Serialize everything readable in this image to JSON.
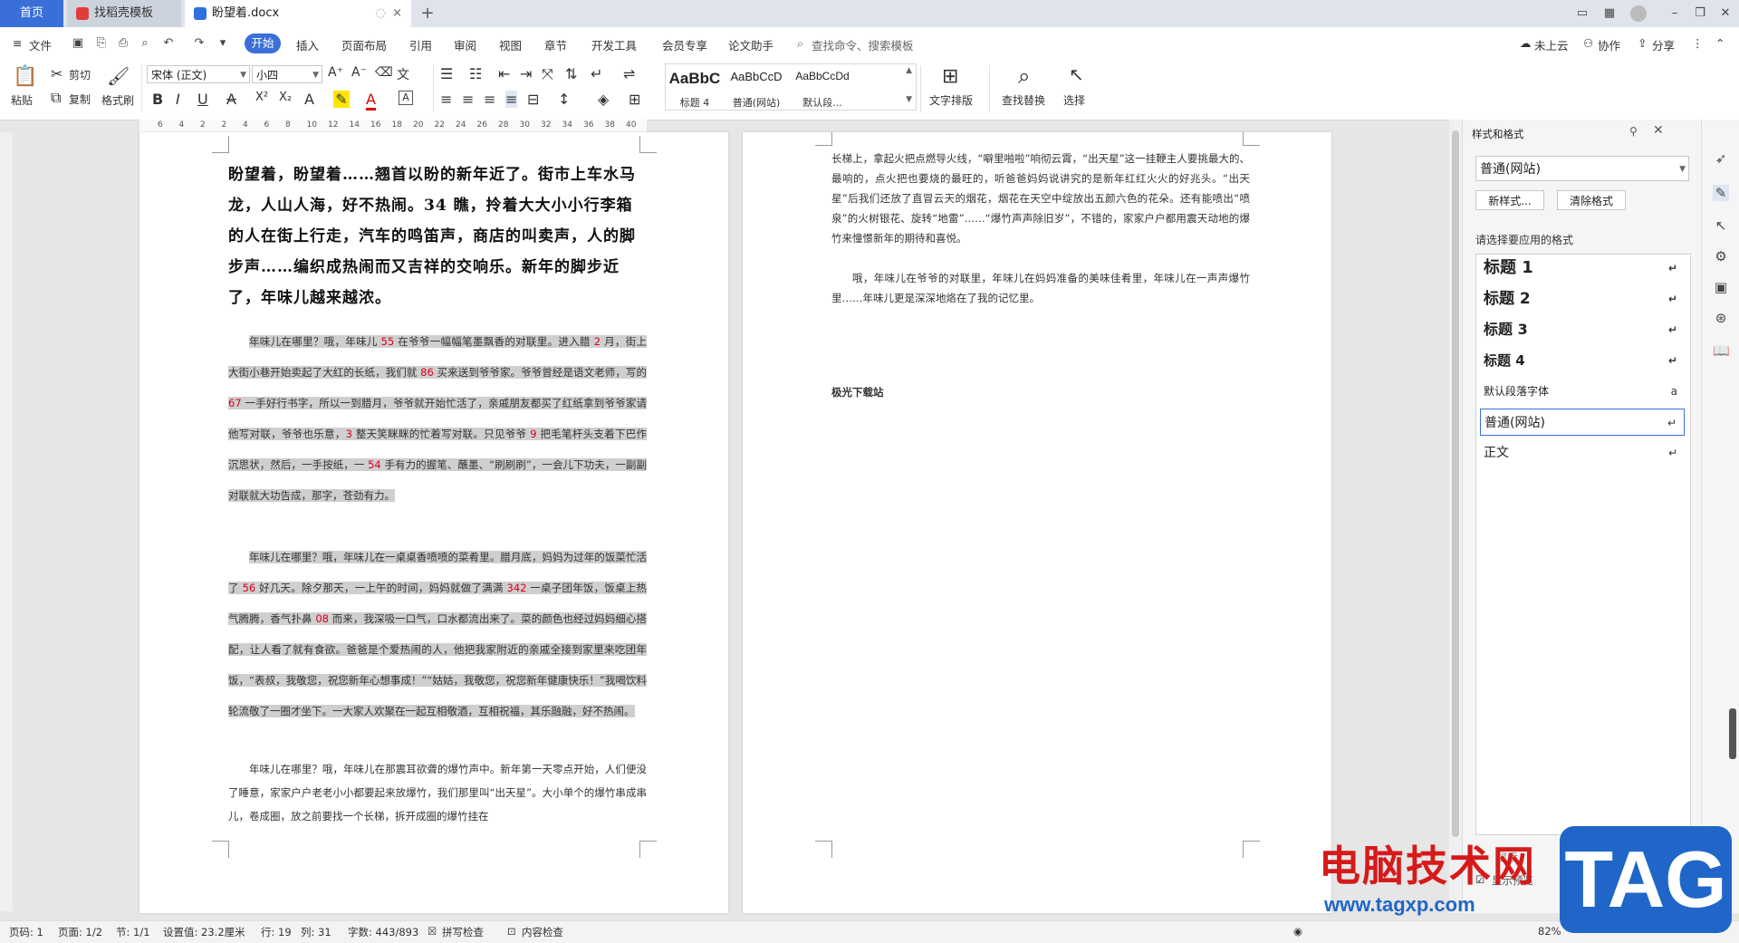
{
  "tabs": {
    "home": "首页",
    "find_template": "找稻壳模板",
    "document": "盼望着.docx",
    "add": "+"
  },
  "menu": {
    "file": "文件",
    "start": "开始",
    "insert": "插入",
    "page_layout": "页面布局",
    "reference": "引用",
    "review": "审阅",
    "view": "视图",
    "chapter": "章节",
    "dev_tools": "开发工具",
    "member": "会员专享",
    "essay": "论文助手",
    "search": "查找命令、搜索模板",
    "cloud": "未上云",
    "collab": "协作",
    "share": "分享"
  },
  "ribbon": {
    "paste": "粘贴",
    "cut": "剪切",
    "copy": "复制",
    "format_painter": "格式刷",
    "font_name": "宋体 (正文)",
    "font_size": "小四",
    "styles": [
      {
        "sample": "AaBbC",
        "name": "标题 4"
      },
      {
        "sample": "AaBbCcD",
        "name": "普通(网站)"
      },
      {
        "sample": "AaBbCcDd",
        "name": "默认段..."
      }
    ],
    "text_layout": "文字排版",
    "find_replace": "查找替换",
    "select": "选择"
  },
  "ruler": [
    "6",
    "4",
    "2",
    "2",
    "4",
    "6",
    "8",
    "10",
    "12",
    "14",
    "16",
    "18",
    "20",
    "22",
    "24",
    "26",
    "28",
    "30",
    "32",
    "34",
    "36",
    "38",
    "40"
  ],
  "page1": {
    "heading": "盼望着，盼望着……翘首以盼的新年近了。街市上车水马龙，人山人海，好不热闹。34 瞧，拎着大大小小行李箱的人在街上行走，汽车的鸣笛声，商店的叫卖声，人的脚步声……编织成热闹而又吉祥的交响乐。新年的脚步近了，年味儿越来越浓。",
    "para1": [
      "年味儿在哪里？哦，年味儿 ",
      "55",
      " 在爷爷一幅幅笔墨飘香的对联里。进入腊 ",
      "2",
      " 月，街上大街小巷开始卖起了大红的长纸，我们就 ",
      "86",
      " 买来送到爷爷家。爷爷曾经是语文老师，写的 ",
      "67",
      " 一手好行书字，所以一到腊月，爷爷就开始忙活了，亲戚朋友都买了红纸拿到爷爷家请他写对联，爷爷也乐意，",
      "3",
      " 整天笑眯眯的忙着写对联。只见爷爷 ",
      "9",
      " 把毛笔杆头支着下巴作沉思状，然后，一手按纸，一 ",
      "54",
      " 手有力的握笔、蘸墨、“刷刷刷”，一会儿下功夫，一副副对联就大功告成，那字，苍劲有力。"
    ],
    "para2": [
      "年味儿在哪里？哦，年味儿在一桌桌香喷喷的菜肴里。腊月底，妈妈为过年的饭菜忙活了 ",
      "56",
      " 好几天。除夕那天，一上午的时间，妈妈就做了满满 ",
      "342",
      " 一桌子团年饭，饭桌上热气腾腾，香气扑鼻 ",
      "08",
      " 而来，我深吸一口气，口水都流出来了。菜的颜色也经过妈妈细心搭配，让人看了就有食欲。爸爸是个爱热闹的人，他把我家附近的亲戚全接到家里来吃团年饭，“表叔，我敬您，祝您新年心想事成！”“姑姑，我敬您，祝您新年健康快乐！”我喝饮料轮流敬了一圈才坐下。一大家人欢聚在一起互相敬酒，互相祝福，其乐融融，好不热闹。"
    ],
    "para3": "年味儿在哪里？哦，年味儿在那震耳欲聋的爆竹声中。新年第一天零点开始，人们便没了睡意，家家户户老老小小都要起来放爆竹，我们那里叫“出天星”。大小单个的爆竹串成串儿，卷成圈，放之前要找一个长梯，拆开成圈的爆竹挂在"
  },
  "page2": {
    "para1": "长梯上，拿起火把点燃导火线，“噼里啪啦”响彻云霄，“出天星”这一挂鞭主人要挑最大的、最响的，点火把也要烧的最旺的，听爸爸妈妈说讲究的是新年红红火火的好兆头。“出天星”后我们还放了直冒云天的烟花，烟花在天空中绽放出五颜六色的花朵。还有能喷出“喷泉”的火树银花、旋转“地雷”……“爆竹声声除旧岁”，不错的，家家户户都用震天动地的爆竹来憧憬新年的期待和喜悦。",
    "para2": "哦，年味儿在爷爷的对联里，年味儿在妈妈准备的美味佳肴里，年味儿在一声声爆竹里……年味儿更是深深地烙在了我的记忆里。",
    "footer": "极光下载站"
  },
  "panel": {
    "title": "样式和格式",
    "current_style": "普通(网站)",
    "new_style": "新样式...",
    "clear_format": "清除格式",
    "prompt": "请选择要应用的格式",
    "styles": [
      "标题 1",
      "标题 2",
      "标题 3",
      "标题 4",
      "默认段落字体",
      "普通(网站)",
      "正文"
    ],
    "show": "显示",
    "preview": "显示预览"
  },
  "status": {
    "page_code": "页码: 1",
    "page": "页面: 1/2",
    "section": "节: 1/1",
    "setting": "设置值: 23.2厘米",
    "row": "行: 19",
    "col": "列: 31",
    "words": "字数: 443/893",
    "spell": "拼写检查",
    "content": "内容检查",
    "zoom": "82%"
  },
  "watermark": {
    "title": "电脑技术网",
    "url": "www.tagxp.com",
    "tag": "TAG"
  },
  "colors": {
    "accent": "#3b6fd8",
    "highlight": "#cfcfcf",
    "number_red": "#d9001b"
  }
}
